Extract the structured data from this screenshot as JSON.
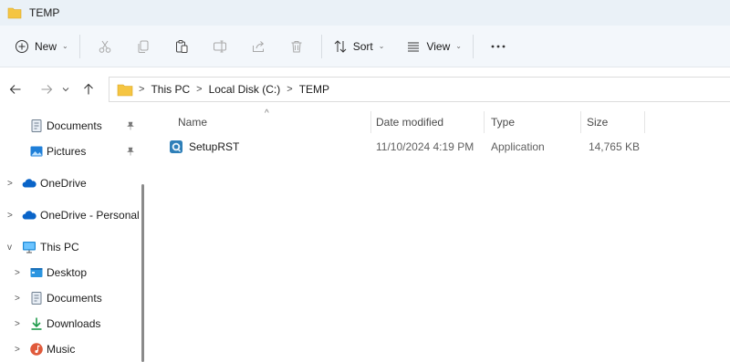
{
  "window": {
    "title": "TEMP"
  },
  "toolbar": {
    "new_label": "New",
    "sort_label": "Sort",
    "view_label": "View",
    "icons": [
      "new-icon",
      "cut-icon",
      "copy-icon",
      "paste-icon",
      "rename-icon",
      "share-icon",
      "delete-icon",
      "sort-icon",
      "view-icon",
      "more-icon"
    ]
  },
  "address": {
    "breadcrumbs": [
      "This PC",
      "Local Disk (C:)",
      "TEMP"
    ],
    "separator": ">"
  },
  "sidebar": {
    "items": [
      {
        "label": "Documents",
        "icon": "documents-icon",
        "pinned": true
      },
      {
        "label": "Pictures",
        "icon": "pictures-icon",
        "pinned": true
      },
      {
        "label": "OneDrive",
        "icon": "onedrive-icon",
        "expand": ">"
      },
      {
        "label": "OneDrive - Personal",
        "icon": "onedrive-icon",
        "expand": ">"
      },
      {
        "label": "This PC",
        "icon": "this-pc-icon",
        "expand": "v"
      },
      {
        "label": "Desktop",
        "icon": "desktop-icon",
        "expand": ">"
      },
      {
        "label": "Documents",
        "icon": "documents-icon",
        "expand": ">"
      },
      {
        "label": "Downloads",
        "icon": "downloads-icon",
        "expand": ">"
      },
      {
        "label": "Music",
        "icon": "music-icon",
        "expand": ">"
      }
    ]
  },
  "file_list": {
    "columns": [
      "Name",
      "Date modified",
      "Type",
      "Size"
    ],
    "sort_indicator": "^",
    "rows": [
      {
        "name": "SetupRST",
        "date_modified": "11/10/2024 4:19 PM",
        "type": "Application",
        "size": "14,765 KB",
        "icon": "setup-app-icon"
      }
    ]
  },
  "colors": {
    "title_bar_bg": "#eaf1f7",
    "toolbar_bg": "#f3f7fb",
    "accent_blue": "#0a64c8",
    "folder_yellow": "#f5c542"
  }
}
